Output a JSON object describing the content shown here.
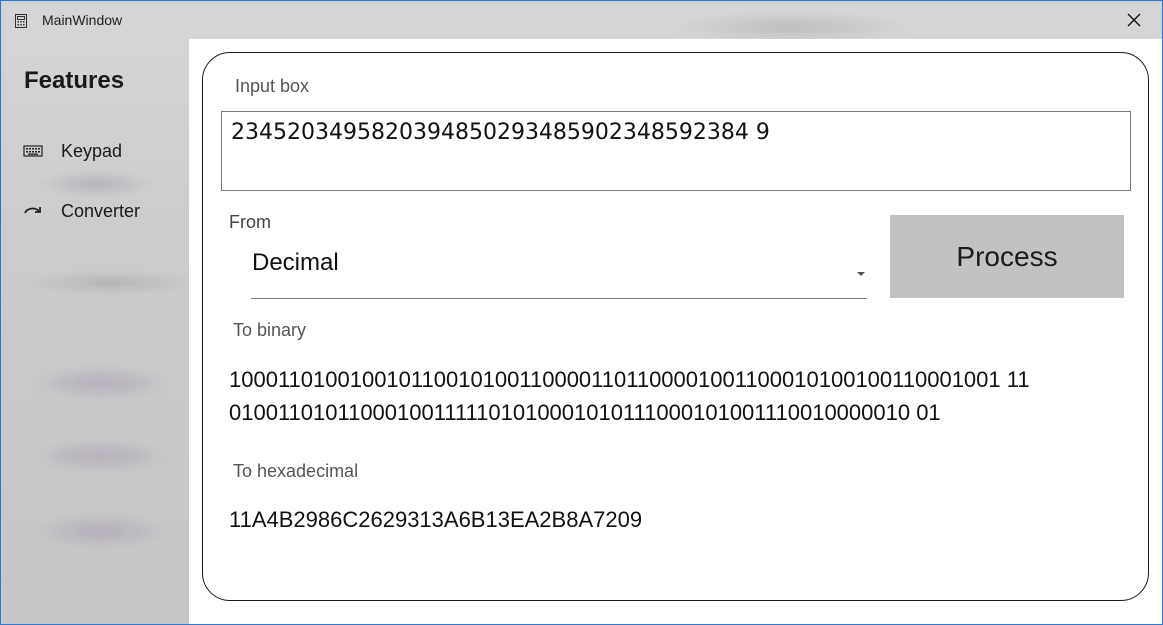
{
  "window": {
    "title": "MainWindow",
    "accent_color": "#2b79d0"
  },
  "titlebar": {
    "app_icon": "calculator-icon",
    "close_icon": "close-icon"
  },
  "sidebar": {
    "title": "Features",
    "items": [
      {
        "label": "Keypad",
        "icon": "keyboard-icon"
      },
      {
        "label": "Converter",
        "icon": "redo-arrow-icon"
      }
    ]
  },
  "converter": {
    "input_label": "Input box",
    "input_value": "2345203495820394850293485902348592384 9",
    "from_label": "From",
    "from_selected": "Decimal",
    "process_label": "Process",
    "process_color": "#c2c2c2",
    "binary_label": "To binary",
    "binary_line1": "1000110100100101100101001100001101100001001100010100100110001001 11",
    "binary_line2": "010011010110001001111101010001010111000101001110010000010 01",
    "hex_label": "To hexadecimal",
    "hex_value": "11A4B2986C2629313A6B13EA2B8A7209"
  }
}
